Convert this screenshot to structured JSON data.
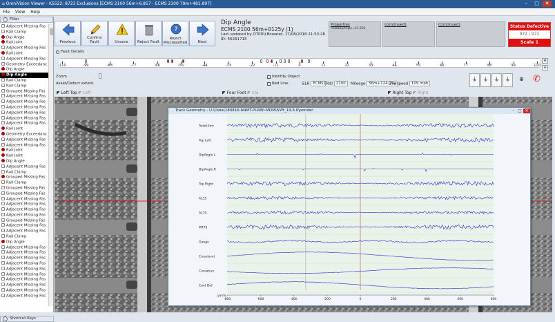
{
  "window": {
    "title": "OmniVision Viewer - K5522: 8723 Exclusions [ECMS 2100 56m+6.857 - ECMS 2100 79m+481.897]"
  },
  "menu": [
    "File",
    "View",
    "Help"
  ],
  "filter": {
    "label": "Filter"
  },
  "fault_list": [
    {
      "label": "Adjacent Missing Fas",
      "icon": "grey"
    },
    {
      "label": "Rail Clamp",
      "icon": "grey"
    },
    {
      "label": "Dip Angle",
      "icon": "red"
    },
    {
      "label": "Rail Joint",
      "icon": "red"
    },
    {
      "label": "Adjacent Missing Fas",
      "icon": "grey"
    },
    {
      "label": "Rail Joint",
      "icon": "red"
    },
    {
      "label": "Adjacent Missing Fas",
      "icon": "grey"
    },
    {
      "label": "Geometry Exceedanc",
      "icon": "grey"
    },
    {
      "label": "Dip Angle",
      "icon": "red"
    },
    {
      "label": "Dip Angle",
      "icon": "red",
      "selected": true
    },
    {
      "label": "Rail Clamp",
      "icon": "grey"
    },
    {
      "label": "Rail Clamp",
      "icon": "grey"
    },
    {
      "label": "Grouped Missing Fas",
      "icon": "grey"
    },
    {
      "label": "Adjacent Missing Fas",
      "icon": "grey"
    },
    {
      "label": "Adjacent Missing Fas",
      "icon": "grey"
    },
    {
      "label": "Adjacent Missing Fas",
      "icon": "grey"
    },
    {
      "label": "Adjacent Missing Fas",
      "icon": "grey"
    },
    {
      "label": "Adjacent Missing Fas",
      "icon": "grey"
    },
    {
      "label": "Adjacent Missing Fas",
      "icon": "grey"
    },
    {
      "label": "Rail Joint",
      "icon": "red"
    },
    {
      "label": "Geometry Exceedanc",
      "icon": "red"
    },
    {
      "label": "Adjacent Missing Fas",
      "icon": "grey"
    },
    {
      "label": "Adjacent Missing Fas",
      "icon": "grey"
    },
    {
      "label": "Rail Joint",
      "icon": "red"
    },
    {
      "label": "Rail Joint",
      "icon": "red"
    },
    {
      "label": "Dip Angle",
      "icon": "red"
    },
    {
      "label": "Adjacent Missing Fas",
      "icon": "grey"
    },
    {
      "label": "Rail Clamp",
      "icon": "grey"
    },
    {
      "label": "Grouped Missing Fas",
      "icon": "red"
    },
    {
      "label": "Rail Clamp",
      "icon": "grey"
    },
    {
      "label": "Grouped Missing Fas",
      "icon": "grey"
    },
    {
      "label": "Grouped Missing Fas",
      "icon": "grey"
    },
    {
      "label": "Adjacent Missing Fas",
      "icon": "grey"
    },
    {
      "label": "Adjacent Missing Fas",
      "icon": "grey"
    },
    {
      "label": "Adjacent Missing Fas",
      "icon": "grey"
    },
    {
      "label": "Adjacent Missing Fas",
      "icon": "grey"
    },
    {
      "label": "Grouped Missing Fas",
      "icon": "grey"
    },
    {
      "label": "Adjacent Missing Fas",
      "icon": "grey"
    },
    {
      "label": "Adjacent Missing Fas",
      "icon": "grey"
    },
    {
      "label": "Rail Clamp",
      "icon": "grey"
    },
    {
      "label": "Dip Angle",
      "icon": "red"
    },
    {
      "label": "Adjacent Missing Fas",
      "icon": "grey"
    },
    {
      "label": "Adjacent Missing Fas",
      "icon": "grey"
    },
    {
      "label": "Adjacent Missing Fas",
      "icon": "grey"
    },
    {
      "label": "Adjacent Missing Fas",
      "icon": "grey"
    },
    {
      "label": "Adjacent Missing Fas",
      "icon": "grey"
    },
    {
      "label": "Adjacent Missing Fas",
      "icon": "grey"
    },
    {
      "label": "Adjacent Missing Fas",
      "icon": "grey"
    },
    {
      "label": "Adjacent Missing Fas",
      "icon": "grey"
    },
    {
      "label": "Adjacent Missing Fas",
      "icon": "grey"
    },
    {
      "label": "Adjacent Missing Fas",
      "icon": "grey"
    }
  ],
  "shortcut_keys": {
    "label": "Shortcut Keys"
  },
  "toolbar": [
    {
      "label": "Previous",
      "icon": "arrow-left-icon"
    },
    {
      "label": "Confirm Fault",
      "icon": "pencil-icon"
    },
    {
      "label": "Unsure",
      "icon": "warning-icon"
    },
    {
      "label": "Reject Fault",
      "icon": "trash-icon"
    },
    {
      "label": "Reject Misclassified",
      "icon": "help-icon"
    },
    {
      "label": "Next",
      "icon": "arrow-right-icon"
    }
  ],
  "fault": {
    "type": "Dip Angle",
    "location": "ECMS 2100 56m+0125y (1)",
    "updated": "Last updated by OTPD\\LBowater, 17/08/2018 21:53:28",
    "id": "ID: 56261715"
  },
  "properties": {
    "header": "Properties",
    "value": "PeakDipAngle=21.501"
  },
  "continued1": {
    "header": "(continued)"
  },
  "continued2": {
    "header": "(continued)"
  },
  "status": {
    "title": "Status Defective",
    "count": "972 / 972",
    "scale": "Scale 1"
  },
  "fault_details": {
    "label": "Fault Details"
  },
  "ruler": {
    "ticks": [
      -110,
      -99,
      -88,
      -77,
      -66,
      -55,
      -44,
      -33,
      -22,
      -11,
      0,
      11,
      22,
      33,
      44,
      55,
      66,
      77,
      88,
      99,
      110
    ]
  },
  "zoom": {
    "label": "Zoom"
  },
  "asset_defect": {
    "label": "Asset/Defect extent"
  },
  "identify_object": {
    "label": "Identify Object"
  },
  "red_line": {
    "label": "Red Line"
  },
  "elr": {
    "label": "ELR",
    "value": "ECMS"
  },
  "trid": {
    "label": "TRID",
    "value": "2100"
  },
  "mileage": {
    "label": "Mileage",
    "value": "56m+124.15y"
  },
  "linespeed": {
    "label": "Linespeed",
    "value": "109 mph"
  },
  "cameras": [
    {
      "label": "Left Top",
      "other": "Left"
    },
    {
      "label": "Four Foot",
      "other": "n/a"
    },
    {
      "label": "Right Top",
      "other": "Right"
    }
  ],
  "popup": {
    "title": "Track Geometry - U:\\Data\\180816-N4MT-PLR80-MDM\\SVft_19.6.6\\ponder",
    "channels": [
      "Twist(3m)",
      "Top Left",
      "DipAngle L",
      "DipAngle R",
      "Top Right",
      "AL35",
      "AL70",
      "MT70",
      "Gauge",
      "Crosslevel",
      "Curvature",
      "Cant Def"
    ],
    "x_ticks": [
      "-800",
      "-600",
      "-400",
      "-200",
      "0",
      "200",
      "400",
      "600",
      "800"
    ],
    "x_unit": "yards"
  },
  "colors": {
    "accent": "#2a5a95",
    "status_red": "#e01010",
    "trace": "#2a2ad0",
    "marker_red": "#c00000"
  }
}
